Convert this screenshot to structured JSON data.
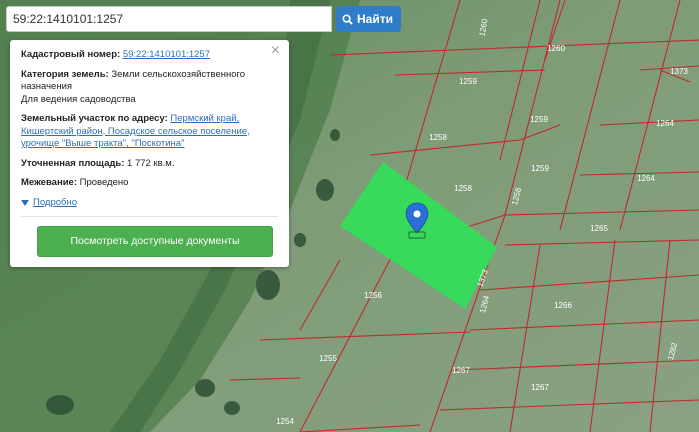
{
  "search": {
    "value": "59:22:1410101:1257",
    "button_label": "Найти"
  },
  "info": {
    "cadastral_label": "Кадастровый номер:",
    "cadastral_value": "59:22:1410101:1257",
    "category_label": "Категория земель:",
    "category_value": "Земли сельскохозяйственного назначения",
    "use_value": "Для ведения садоводства",
    "address_label": "Земельный участок по адресу:",
    "address_value": "Пермский край, Кишертский район, Посадское сельское поселение, урочище \"Выше тракта\", \"Поскотина\"",
    "area_label": "Уточненная площадь:",
    "area_value": "1 772 кв.м.",
    "survey_label": "Межевание:",
    "survey_value": "Проведено",
    "more_label": "Подробно",
    "docs_button": "Посмотреть доступные документы",
    "close": "×"
  },
  "parcels": [
    {
      "label": "1260"
    },
    {
      "label": "1260"
    },
    {
      "label": "1373"
    },
    {
      "label": "1259"
    },
    {
      "label": "1259"
    },
    {
      "label": "1264"
    },
    {
      "label": "1258"
    },
    {
      "label": "1259"
    },
    {
      "label": "1264"
    },
    {
      "label": "1258"
    },
    {
      "label": "1258"
    },
    {
      "label": "1265"
    },
    {
      "label": "1373"
    },
    {
      "label": "1264"
    },
    {
      "label": "1256"
    },
    {
      "label": "1266"
    },
    {
      "label": "1255"
    },
    {
      "label": "1267"
    },
    {
      "label": "1282"
    },
    {
      "label": "1267"
    },
    {
      "label": "1254"
    }
  ],
  "colors": {
    "selected_parcel": "#32e05a",
    "boundary": "#c2282e",
    "marker": "#2b6fd6"
  }
}
